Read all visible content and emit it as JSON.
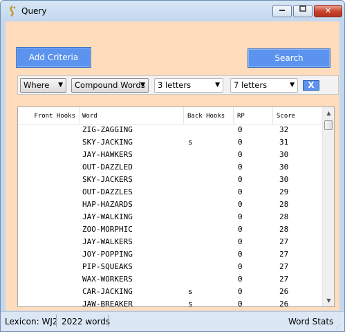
{
  "window": {
    "title": "Query"
  },
  "buttons": {
    "add_criteria": "Add Criteria",
    "search": "Search",
    "remove": "X"
  },
  "criteria": {
    "field": "Where",
    "type": "Compound Words",
    "min": "3 letters",
    "max": "7 letters"
  },
  "table": {
    "headers": {
      "front_hooks": "Front Hooks",
      "word": "Word",
      "back_hooks": "Back Hooks",
      "rp": "RP",
      "score": "Score"
    },
    "rows": [
      {
        "front": "",
        "word": "ZIG-ZAGGING",
        "back": "",
        "rp": "0",
        "score": "32"
      },
      {
        "front": "",
        "word": "SKY-JACKING",
        "back": "s",
        "rp": "0",
        "score": "31"
      },
      {
        "front": "",
        "word": "JAY-HAWKERS",
        "back": "",
        "rp": "0",
        "score": "30"
      },
      {
        "front": "",
        "word": "OUT-DAZZLED",
        "back": "",
        "rp": "0",
        "score": "30"
      },
      {
        "front": "",
        "word": "SKY-JACKERS",
        "back": "",
        "rp": "0",
        "score": "30"
      },
      {
        "front": "",
        "word": "OUT-DAZZLES",
        "back": "",
        "rp": "0",
        "score": "29"
      },
      {
        "front": "",
        "word": "HAP-HAZARDS",
        "back": "",
        "rp": "0",
        "score": "28"
      },
      {
        "front": "",
        "word": "JAY-WALKING",
        "back": "",
        "rp": "0",
        "score": "28"
      },
      {
        "front": "",
        "word": "ZOO-MORPHIC",
        "back": "",
        "rp": "0",
        "score": "28"
      },
      {
        "front": "",
        "word": "JAY-WALKERS",
        "back": "",
        "rp": "0",
        "score": "27"
      },
      {
        "front": "",
        "word": "JOY-POPPING",
        "back": "",
        "rp": "0",
        "score": "27"
      },
      {
        "front": "",
        "word": "PIP-SQUEAKS",
        "back": "",
        "rp": "0",
        "score": "27"
      },
      {
        "front": "",
        "word": "WAX-WORKERS",
        "back": "",
        "rp": "0",
        "score": "27"
      },
      {
        "front": "",
        "word": "CAR-JACKING",
        "back": "s",
        "rp": "0",
        "score": "26"
      },
      {
        "front": "",
        "word": "JAW-BREAKER",
        "back": "s",
        "rp": "0",
        "score": "26"
      }
    ]
  },
  "status": {
    "lexicon": "Lexicon: WJ2",
    "word_count": "2022 words",
    "stats": "Word Stats"
  },
  "colors": {
    "client_bg": "#ffdcbc",
    "accent_button": "#5b93ee"
  }
}
